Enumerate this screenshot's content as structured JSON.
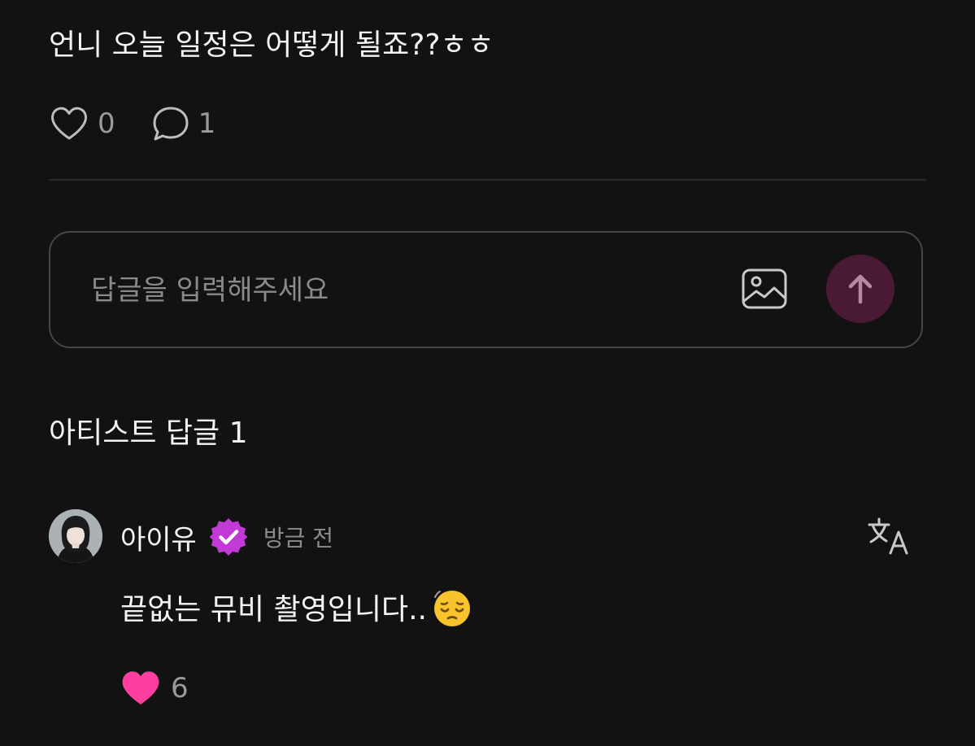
{
  "post": {
    "text": "언니 오늘 일정은 어떻게 될죠??ㅎㅎ",
    "likes": "0",
    "comments": "1"
  },
  "reply_input": {
    "placeholder": "답글을 입력해주세요"
  },
  "artist_replies": {
    "title": "아티스트 답글 1"
  },
  "comment": {
    "author": "아이유",
    "time": "방금 전",
    "text": "끝없는 뮤비 촬영입니다..",
    "emoji": "pensive-face",
    "likes": "6"
  },
  "colors": {
    "background": "#121212",
    "send_button": "#4a1a34",
    "verified_badge": "#c23ad6",
    "liked_heart": "#ff3fa0"
  }
}
